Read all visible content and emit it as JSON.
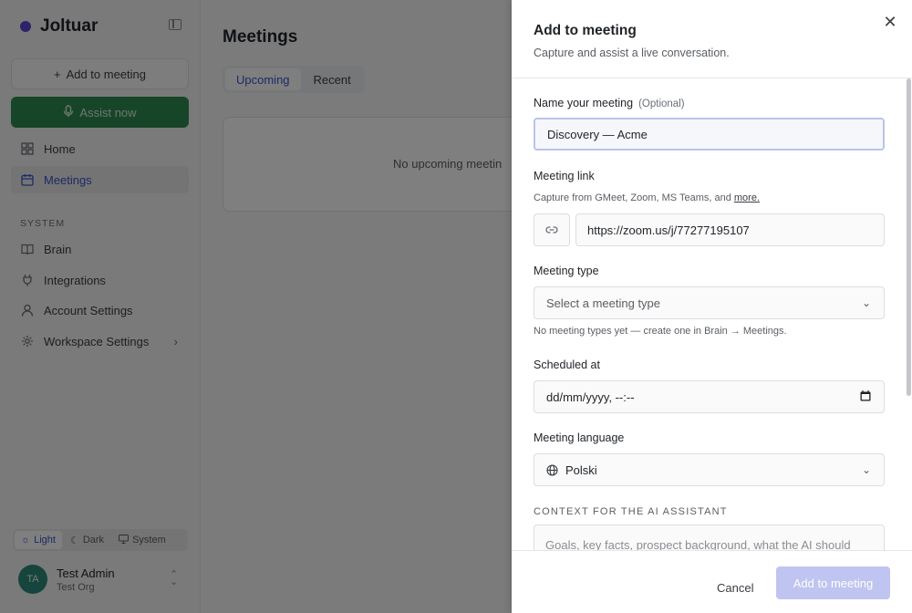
{
  "app": {
    "name": "Joltuar"
  },
  "sidebar": {
    "add_meeting": "Add to meeting",
    "assist_now": "Assist now",
    "nav": [
      {
        "label": "Home",
        "icon": "grid-icon"
      },
      {
        "label": "Meetings",
        "icon": "calendar-icon"
      }
    ],
    "section_label": "SYSTEM",
    "system_nav": [
      {
        "label": "Brain",
        "icon": "book-icon"
      },
      {
        "label": "Integrations",
        "icon": "plug-icon"
      },
      {
        "label": "Account Settings",
        "icon": "user-icon"
      },
      {
        "label": "Workspace Settings",
        "icon": "gear-icon"
      }
    ],
    "theme": {
      "light": "Light",
      "dark": "Dark",
      "system": "System",
      "selected": "Light"
    },
    "user": {
      "initials": "TA",
      "name": "Test Admin",
      "org": "Test Org"
    }
  },
  "main": {
    "title": "Meetings",
    "tabs": [
      "Upcoming",
      "Recent"
    ],
    "active_tab": "Upcoming",
    "empty_text": "No upcoming meetin"
  },
  "dialog": {
    "title": "Add to meeting",
    "subtitle": "Capture and assist a live conversation.",
    "name_label": "Name your meeting",
    "name_optional": "(Optional)",
    "name_value": "Discovery — Acme",
    "link_label": "Meeting link",
    "link_hint": "Capture from GMeet, Zoom, MS Teams, and",
    "link_hint_more": "more.",
    "link_value": "https://zoom.us/j/77277195107",
    "type_label": "Meeting type",
    "type_placeholder": "Select a meeting type",
    "type_hint": "No meeting types yet — create one in Brain → Meetings.",
    "scheduled_label": "Scheduled at",
    "scheduled_placeholder": "dd/mm/yyyy, --:--",
    "language_label": "Meeting language",
    "language_value": "Polski",
    "context_label": "CONTEXT FOR THE AI ASSISTANT",
    "context_placeholder": "Goals, key facts, prospect background, what the AI should",
    "cancel": "Cancel",
    "submit": "Add to meeting"
  },
  "colors": {
    "accent": "#3a55c8",
    "assist_green": "#2e8b50",
    "submit_disabled": "#c0c4f0"
  }
}
